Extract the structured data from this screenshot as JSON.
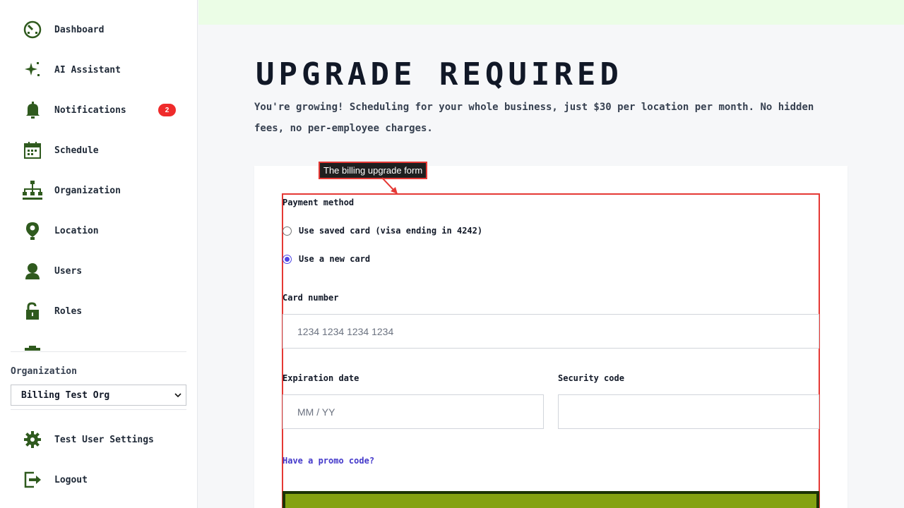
{
  "sidebar": {
    "items": [
      {
        "label": "Dashboard",
        "icon": "dashboard-icon"
      },
      {
        "label": "AI Assistant",
        "icon": "sparkle-icon"
      },
      {
        "label": "Notifications",
        "icon": "bell-icon",
        "badge": "2"
      },
      {
        "label": "Schedule",
        "icon": "calendar-icon"
      },
      {
        "label": "Organization",
        "icon": "org-chart-icon"
      },
      {
        "label": "Location",
        "icon": "location-pin-icon"
      },
      {
        "label": "Users",
        "icon": "user-icon"
      },
      {
        "label": "Roles",
        "icon": "unlock-icon"
      }
    ],
    "org_label": "Organization",
    "org_selected": "Billing Test Org",
    "bottom_items": [
      {
        "label": "Test User Settings",
        "icon": "gear-icon"
      },
      {
        "label": "Logout",
        "icon": "logout-icon"
      }
    ]
  },
  "main": {
    "title": "UPGRADE REQUIRED",
    "subtitle": "You're growing! Scheduling for your whole business, just $30 per location per month. No hidden fees, no per-employee charges."
  },
  "annotation": {
    "label": "The billing upgrade form"
  },
  "form": {
    "payment_method_label": "Payment method",
    "options": [
      {
        "label": "Use saved card (visa ending in 4242)",
        "checked": false
      },
      {
        "label": "Use a new card",
        "checked": true
      }
    ],
    "card_number_label": "Card number",
    "card_number_placeholder": "1234 1234 1234 1234",
    "expiration_label": "Expiration date",
    "expiration_placeholder": "MM / YY",
    "security_label": "Security code",
    "security_placeholder": "",
    "promo_link": "Have a promo code?"
  },
  "colors": {
    "accent": "#4f46e5",
    "icon_green": "#2f5a1e",
    "badge": "#ef2b2b",
    "annotation_border": "#e53935",
    "submit_bg": "#84a211"
  }
}
